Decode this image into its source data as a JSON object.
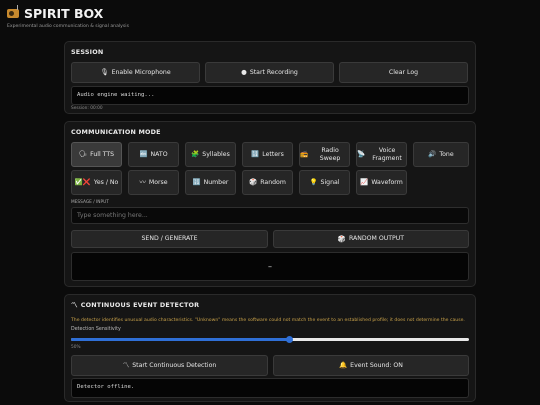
{
  "header": {
    "title": "SPIRIT BOX",
    "subtitle": "Experimental audio communication & signal analysis"
  },
  "session": {
    "title": "SESSION",
    "enable_mic": "Enable Microphone",
    "start_recording": "Start Recording",
    "clear_log": "Clear Log",
    "log": "Audio engine waiting...",
    "session_time": "Session: 00:00"
  },
  "communication": {
    "title": "COMMUNICATION MODE",
    "modes": [
      {
        "icon": "speech-head-icon",
        "label": "Full TTS",
        "active": true
      },
      {
        "icon": "abc-icon",
        "label": "NATO"
      },
      {
        "icon": "puzzle-icon",
        "label": "Syllables"
      },
      {
        "icon": "numbers-icon",
        "label": "Letters"
      },
      {
        "icon": "radio-icon",
        "label": "Radio Sweep"
      },
      {
        "icon": "satellite-icon",
        "label": "Voice Fragment"
      },
      {
        "icon": "speaker-icon",
        "label": "Tone"
      },
      {
        "icon": "check-cross-icon",
        "label": "Yes / No"
      },
      {
        "icon": "wave-icon",
        "label": "Morse"
      },
      {
        "icon": "numbers-icon",
        "label": "Number"
      },
      {
        "icon": "dice-icon",
        "label": "Random"
      },
      {
        "icon": "bulb-icon",
        "label": "Signal"
      },
      {
        "icon": "chart-icon",
        "label": "Waveform"
      }
    ],
    "message_label": "MESSAGE / INPUT",
    "message_placeholder": "Type something here...",
    "send_label": "SEND / GENERATE",
    "random_output_label": "RANDOM OUTPUT",
    "output_value": "–"
  },
  "detector": {
    "title": "CONTINUOUS EVENT DETECTOR",
    "note": "The detector identifies unusual audio characteristics. \"Unknown\" means the software could not match the event to an established profile; it does not determine the cause.",
    "sensitivity_label": "Detection Sensitivity",
    "sensitivity_value": "50%",
    "sensitivity_fraction": 0.55,
    "start_label": "Start Continuous Detection",
    "event_sound_label": "Event Sound: ON",
    "log": "Detector offline."
  },
  "colors": {
    "accent": "#2f6fd6",
    "warning_text": "#c9a24a",
    "background": "#0b0b0b",
    "panel": "#151515"
  }
}
